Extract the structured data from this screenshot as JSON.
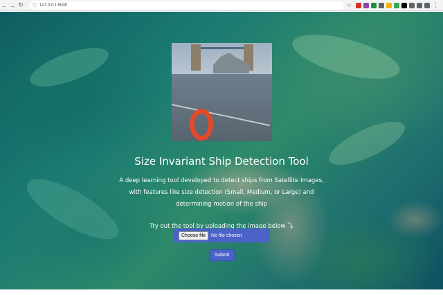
{
  "browser": {
    "back_icon": "arrow-left-icon",
    "forward_icon": "arrow-right-icon",
    "reload_icon": "reload-icon",
    "url": "127.0.0.1:5000",
    "star_icon": "star-icon",
    "menu_icon": "more-vert-icon",
    "extension_colors": [
      "#d93025",
      "#8e44ad",
      "#1e8e3e",
      "#5f6368",
      "#f4b400",
      "#34a853",
      "#000000",
      "#5f6368",
      "#5f6368",
      "#5f6368"
    ]
  },
  "hero": {
    "title": "Size Invariant Ship Detection Tool",
    "description": "A deep learning tool developed to detect ships from Satellite Images, with features like size detection (Small, Medium, or Large) and determining motion of the ship",
    "cta": "Try out the tool by uploading the image below ⤵"
  },
  "upload": {
    "choose_label": "Choose file",
    "status": "No file chosen",
    "submit_label": "Submit"
  },
  "colors": {
    "accent": "#4b63c8"
  }
}
